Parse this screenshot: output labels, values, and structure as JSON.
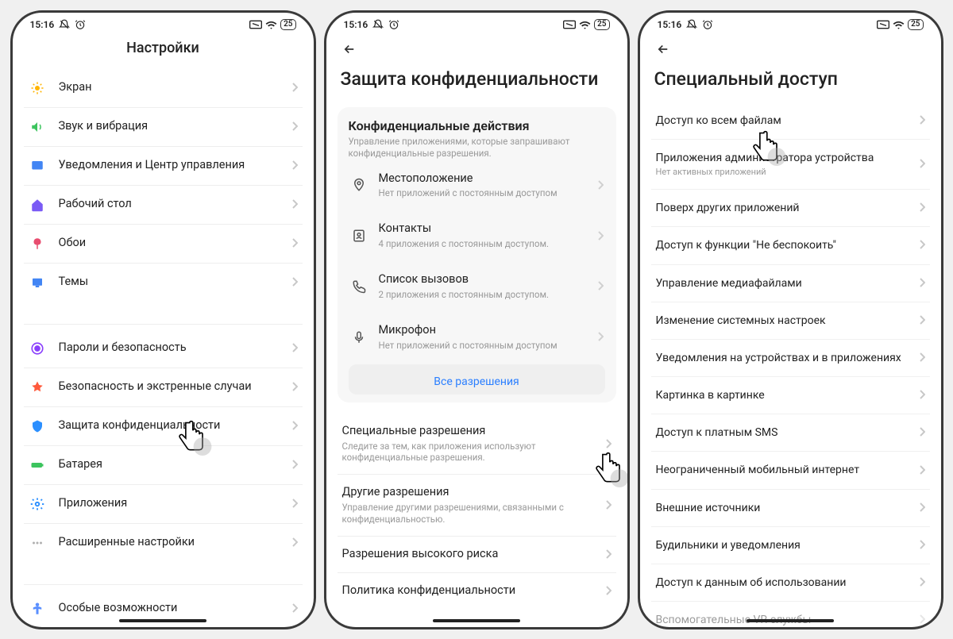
{
  "status": {
    "time": "15:16",
    "battery": "25"
  },
  "phone1": {
    "title": "Настройки",
    "group1": [
      {
        "icon": "sun",
        "label": "Экран"
      },
      {
        "icon": "sound",
        "label": "Звук и вибрация"
      },
      {
        "icon": "noti",
        "label": "Уведомления и Центр управления"
      },
      {
        "icon": "home",
        "label": "Рабочий стол"
      },
      {
        "icon": "wall",
        "label": "Обои"
      },
      {
        "icon": "theme",
        "label": "Темы"
      }
    ],
    "group2": [
      {
        "icon": "lock",
        "label": "Пароли и безопасность"
      },
      {
        "icon": "safety",
        "label": "Безопасность и экстренные случаи"
      },
      {
        "icon": "privacy",
        "label": "Защита конфиденциальности"
      },
      {
        "icon": "battery",
        "label": "Батарея"
      },
      {
        "icon": "apps",
        "label": "Приложения"
      },
      {
        "icon": "more",
        "label": "Расширенные настройки"
      }
    ],
    "group3": [
      {
        "icon": "access",
        "label": "Особые возможности"
      }
    ]
  },
  "phone2": {
    "title": "Защита конфиденциальности",
    "card": {
      "title": "Конфиденциальные действия",
      "sub": "Управление приложениями, которые запрашивают конфиденциальные разрешения.",
      "rows": [
        {
          "icon": "location",
          "label": "Местоположение",
          "sub": "Нет приложений с постоянным доступом"
        },
        {
          "icon": "contacts",
          "label": "Контакты",
          "sub": "4 приложения с постоянным доступом."
        },
        {
          "icon": "calls",
          "label": "Список вызовов",
          "sub": "2 приложения с постоянным доступом."
        },
        {
          "icon": "mic",
          "label": "Микрофон",
          "sub": "Нет приложений с постоянным доступом"
        }
      ],
      "button": "Все разрешения"
    },
    "items": [
      {
        "label": "Специальные разрешения",
        "sub": "Следите за тем, как приложения используют конфиденциальные разрешения."
      },
      {
        "label": "Другие разрешения",
        "sub": "Управление другими разрешениями, связанными с конфиденциальностью."
      },
      {
        "label": "Разрешения высокого риска"
      },
      {
        "label": "Политика конфиденциальности"
      }
    ]
  },
  "phone3": {
    "title": "Специальный доступ",
    "items": [
      {
        "label": "Доступ ко всем файлам"
      },
      {
        "label": "Приложения администратора устройства",
        "sub": "Нет активных приложений"
      },
      {
        "label": "Поверх других приложений"
      },
      {
        "label": "Доступ к функции \"Не беспокоить\""
      },
      {
        "label": "Управление медиафайлами"
      },
      {
        "label": "Изменение системных настроек"
      },
      {
        "label": "Уведомления на устройствах и в приложениях"
      },
      {
        "label": "Картинка в картинке"
      },
      {
        "label": "Доступ к платным SMS"
      },
      {
        "label": "Неограниченный мобильный интернет"
      },
      {
        "label": "Внешние источники"
      },
      {
        "label": "Будильники и уведомления"
      },
      {
        "label": "Доступ к данным об использовании"
      },
      {
        "label": "Вспомогательные VR-службы"
      }
    ]
  }
}
